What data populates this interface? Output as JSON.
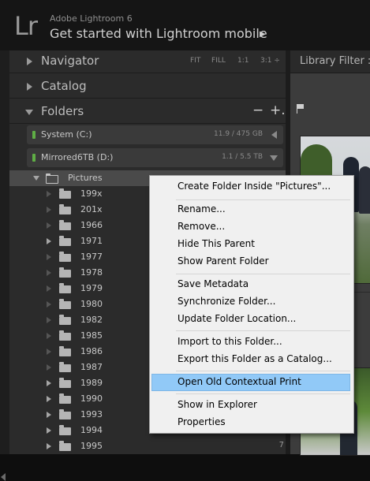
{
  "app": {
    "logo": "Lr",
    "name": "Adobe Lightroom 6",
    "mobile_link": "Get started with Lightroom mobile",
    "mobile_arrow": "▶"
  },
  "panels": {
    "navigator": "Navigator",
    "navigator_options": [
      "FIT",
      "FILL",
      "1:1",
      "3:1 ÷"
    ],
    "catalog": "Catalog",
    "folders": "Folders",
    "folders_minus": "−",
    "folders_plus": "+."
  },
  "volumes": [
    {
      "name": "System (C:)",
      "size": "11.9 / 475 GB"
    },
    {
      "name": "Mirrored6TB (D:)",
      "size": "1.1 / 5.5 TB"
    }
  ],
  "folders": {
    "root": "Pictures",
    "items": [
      {
        "name": "199x",
        "count": ""
      },
      {
        "name": "201x",
        "count": ""
      },
      {
        "name": "1966",
        "count": ""
      },
      {
        "name": "1971",
        "count": ""
      },
      {
        "name": "1977",
        "count": ""
      },
      {
        "name": "1978",
        "count": ""
      },
      {
        "name": "1979",
        "count": ""
      },
      {
        "name": "1980",
        "count": ""
      },
      {
        "name": "1982",
        "count": ""
      },
      {
        "name": "1985",
        "count": ""
      },
      {
        "name": "1986",
        "count": ""
      },
      {
        "name": "1987",
        "count": ""
      },
      {
        "name": "1989",
        "count": ""
      },
      {
        "name": "1990",
        "count": ""
      },
      {
        "name": "1993",
        "count": ""
      },
      {
        "name": "1994",
        "count": ""
      },
      {
        "name": "1995",
        "count": "7"
      }
    ]
  },
  "library_filter": "Library Filter :",
  "context_menu": {
    "items": [
      "Create Folder Inside \"Pictures\"...",
      "Rename...",
      "Remove...",
      "Hide This Parent",
      "Show Parent Folder",
      "Save Metadata",
      "Synchronize Folder...",
      "Update Folder Location...",
      "Import to this Folder...",
      "Export this Folder as a Catalog...",
      "Open Old Contextual Print",
      "Show in Explorer",
      "Properties"
    ],
    "highlighted": "Open Old Contextual Print"
  }
}
